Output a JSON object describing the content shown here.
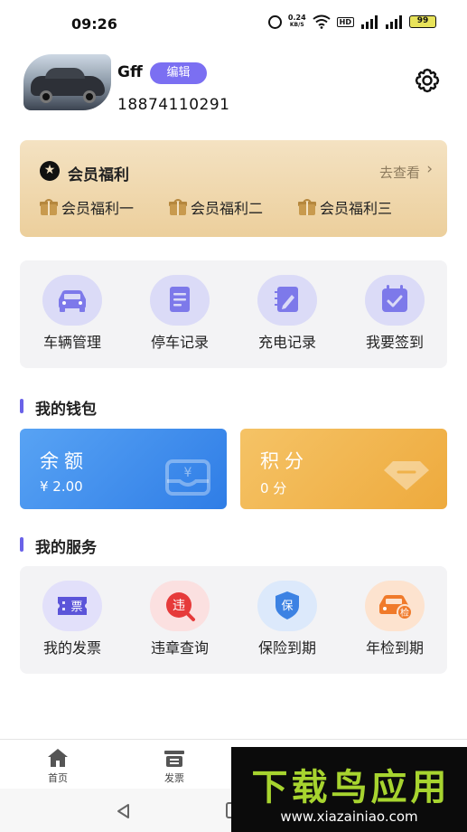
{
  "status_bar": {
    "time": "09:26",
    "net_speed": "0.24",
    "net_unit": "KB/S",
    "hd": "HD",
    "battery": "99"
  },
  "profile": {
    "name": "Gff",
    "edit_label": "编辑",
    "phone": "18874110291"
  },
  "vip": {
    "title": "会员福利",
    "more": "去查看",
    "benefits": [
      "会员福利一",
      "会员福利二",
      "会员福利三"
    ]
  },
  "quick_actions": [
    {
      "label": "车辆管理",
      "icon": "car-icon"
    },
    {
      "label": "停车记录",
      "icon": "document-icon"
    },
    {
      "label": "充电记录",
      "icon": "notebook-pen-icon"
    },
    {
      "label": "我要签到",
      "icon": "calendar-check-icon"
    }
  ],
  "wallet": {
    "title": "我的钱包",
    "balance_label": "余额",
    "balance_value": "¥ 2.00",
    "points_label": "积分",
    "points_value": "0 分"
  },
  "services": {
    "title": "我的服务",
    "items": [
      {
        "label": "我的发票",
        "icon": "invoice-icon",
        "glyph": "票"
      },
      {
        "label": "违章查询",
        "icon": "violation-icon",
        "glyph": "违"
      },
      {
        "label": "保险到期",
        "icon": "insurance-shield-icon",
        "glyph": "保"
      },
      {
        "label": "年检到期",
        "icon": "annual-inspection-icon",
        "glyph": "检"
      }
    ]
  },
  "tabbar": {
    "tabs": [
      {
        "label": "首页",
        "icon": "home-icon"
      },
      {
        "label": "发票",
        "icon": "printer-icon"
      }
    ]
  },
  "watermark": {
    "title": "下载鸟应用",
    "url": "www.xiazainiao.com"
  },
  "colors": {
    "accent": "#7b6ff2",
    "balance_card": "#3a87ea",
    "points_card": "#f0b24a",
    "vip_card": "#f0d7aa"
  }
}
